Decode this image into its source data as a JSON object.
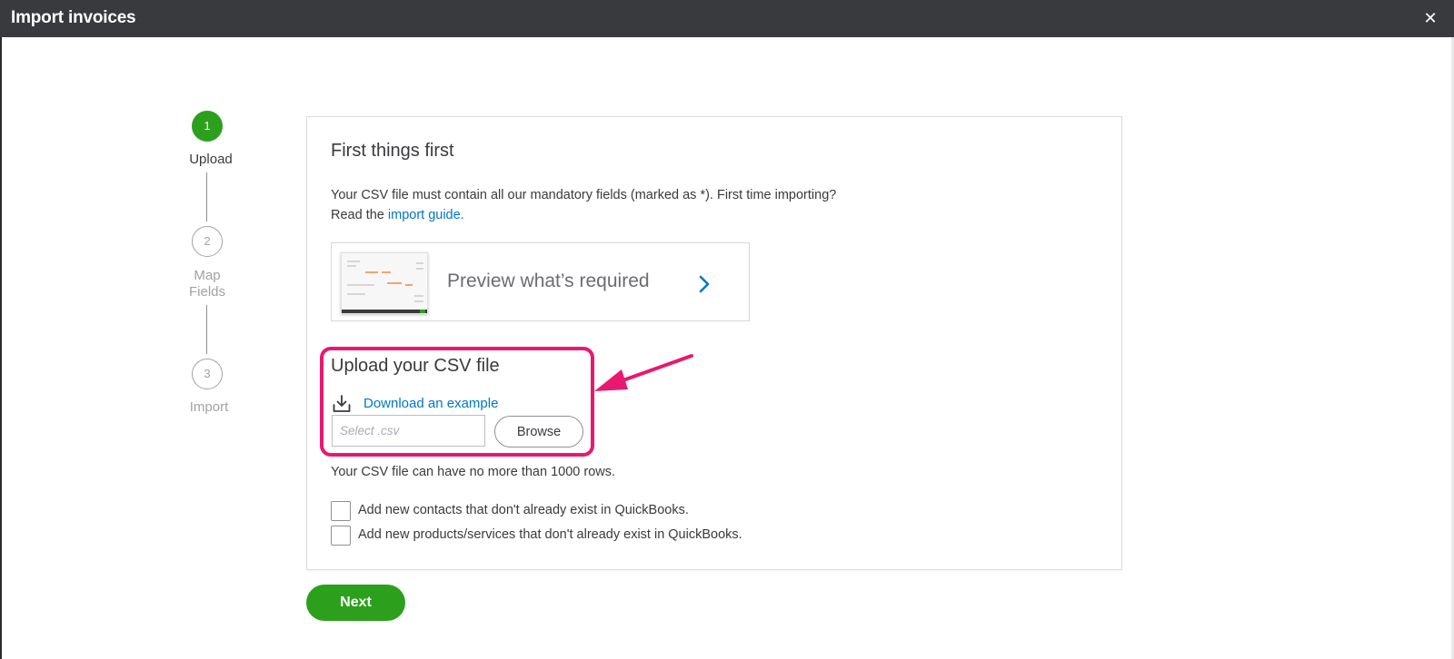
{
  "window": {
    "title": "Import invoices",
    "close_glyph": "✕"
  },
  "stepper": {
    "steps": [
      {
        "number": "1",
        "label": "Upload",
        "state": "active"
      },
      {
        "number": "2",
        "label_line1": "Map",
        "label_line2": "Fields",
        "state": "inactive"
      },
      {
        "number": "3",
        "label": "Import",
        "state": "inactive"
      }
    ]
  },
  "intro": {
    "heading": "First things first",
    "line1": "Your CSV file must contain all our mandatory fields (marked as *). First time importing?",
    "line2_prefix": "Read the ",
    "guide_link": "import guide.",
    "preview_label": "Preview what’s required"
  },
  "upload": {
    "heading": "Upload your CSV file",
    "download_link": "Download an example",
    "file_placeholder": "Select .csv",
    "browse_label": "Browse",
    "rows_note": "Your CSV file can have no more than 1000 rows."
  },
  "options": {
    "add_contacts": "Add new contacts that don't already exist in QuickBooks.",
    "add_products": "Add new products/services that don't already exist in QuickBooks."
  },
  "footer": {
    "next_label": "Next"
  },
  "colors": {
    "titlebar": "#393a3d",
    "accent_green": "#2ca01c",
    "link_blue": "#0077c5",
    "highlight_pink": "#e8196f"
  }
}
